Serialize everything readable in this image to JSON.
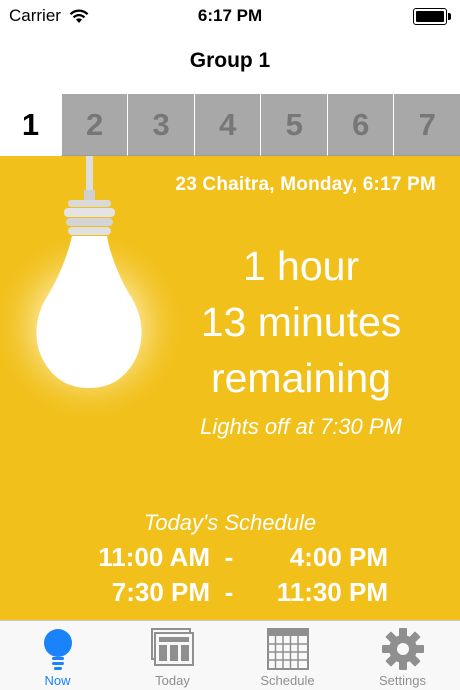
{
  "status_bar": {
    "carrier": "Carrier",
    "time": "6:17 PM"
  },
  "nav": {
    "title": "Group 1"
  },
  "group_tabs": [
    {
      "label": "1",
      "active": true
    },
    {
      "label": "2",
      "active": false
    },
    {
      "label": "3",
      "active": false
    },
    {
      "label": "4",
      "active": false
    },
    {
      "label": "5",
      "active": false
    },
    {
      "label": "6",
      "active": false
    },
    {
      "label": "7",
      "active": false
    }
  ],
  "now": {
    "date_line": "23 Chaitra, Monday, 6:17 PM",
    "remaining_line1": "1 hour",
    "remaining_line2": "13 minutes",
    "remaining_line3": "remaining",
    "lights_off": "Lights off at 7:30 PM",
    "bulb_icon": "light-bulb-icon"
  },
  "schedule": {
    "title": "Today's Schedule",
    "slots": [
      {
        "start": "11:00 AM",
        "sep": "-",
        "end": "4:00 PM"
      },
      {
        "start": "7:30 PM",
        "sep": "-",
        "end": "11:30 PM"
      }
    ]
  },
  "tab_bar": [
    {
      "label": "Now",
      "icon": "light-bulb-icon",
      "active": true
    },
    {
      "label": "Today",
      "icon": "newspaper-icon",
      "active": false
    },
    {
      "label": "Schedule",
      "icon": "calendar-icon",
      "active": false
    },
    {
      "label": "Settings",
      "icon": "gear-icon",
      "active": false
    }
  ],
  "colors": {
    "accent_yellow": "#f1c01b",
    "tab_active_blue": "#1a82fb",
    "tab_inactive_gray": "#8f8f8f",
    "group_tab_gray": "#a8a8a8"
  }
}
